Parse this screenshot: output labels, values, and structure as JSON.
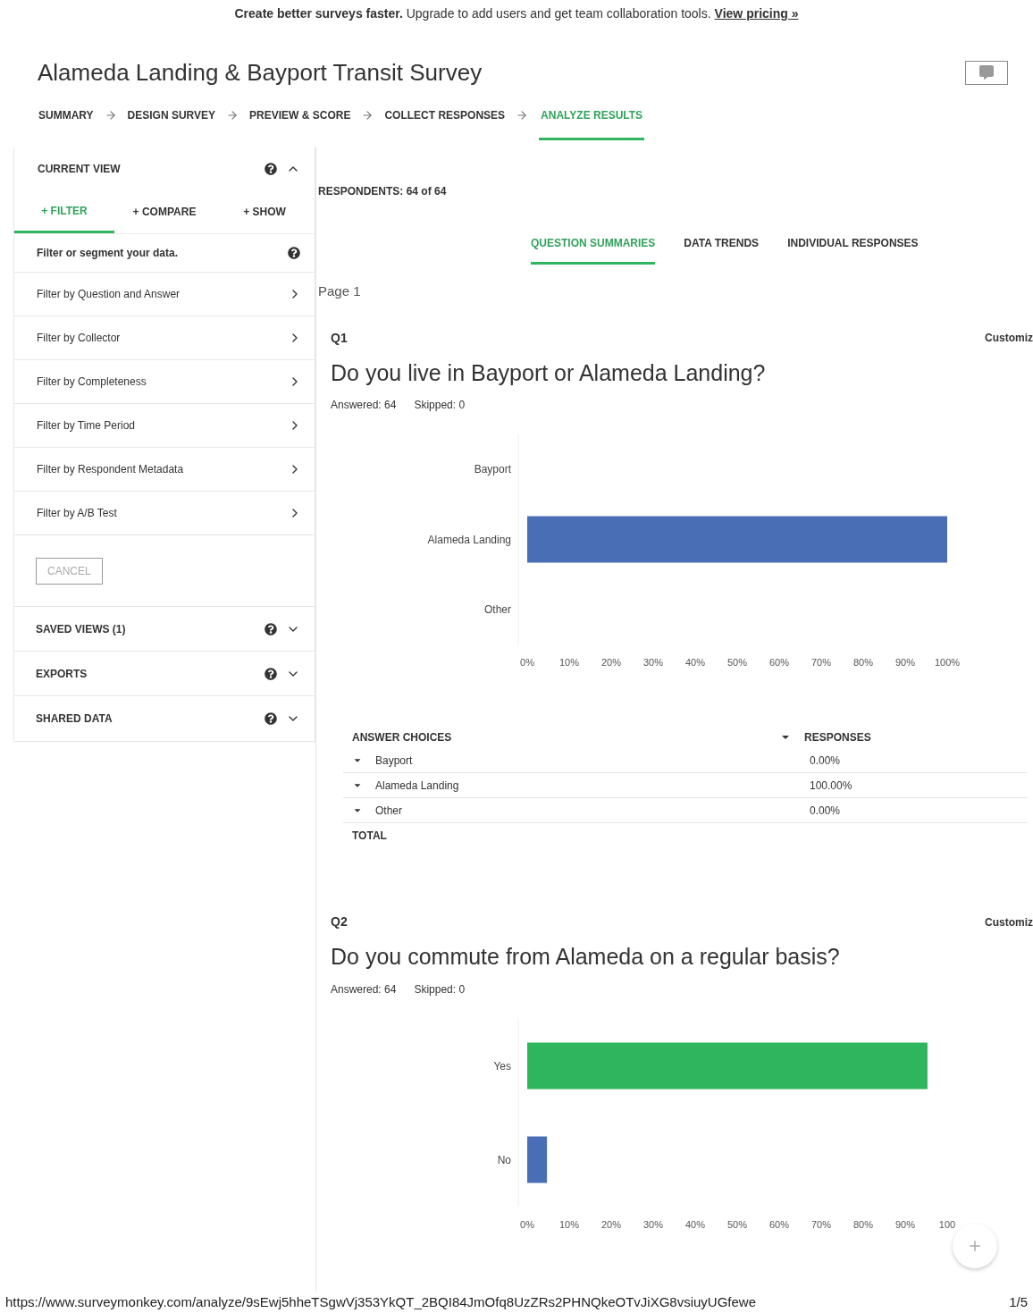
{
  "banner": {
    "text": "**Create better surveys faster.** Upgrade to add users and get team collaboration tools.",
    "link": "View pricing »"
  },
  "survey_title": "Alameda Landing & Bayport Transit Survey",
  "steps": [
    {
      "label": "SUMMARY",
      "selected": false
    },
    {
      "label": "DESIGN SURVEY",
      "selected": false
    },
    {
      "label": "PREVIEW & SCORE",
      "selected": false
    },
    {
      "label": "COLLECT RESPONSES",
      "selected": false
    },
    {
      "label": "ANALYZE RESULTS",
      "selected": true
    }
  ],
  "sidebar": {
    "current_view": {
      "title": "CURRENT VIEW",
      "expanded": true,
      "tabs": [
        {
          "label": "+ FILTER",
          "selected": true
        },
        {
          "label": "+ COMPARE",
          "selected": false
        },
        {
          "label": "+ SHOW",
          "selected": false
        }
      ],
      "hint": "Filter or segment your data.",
      "filters": [
        "Filter by Question and Answer",
        "Filter by Collector",
        "Filter by Completeness",
        "Filter by Time Period",
        "Filter by Respondent Metadata",
        "Filter by A/B Test"
      ],
      "cancel_button": "CANCEL"
    },
    "sections": [
      {
        "title": "SAVED VIEWS (1)",
        "expanded": false
      },
      {
        "title": "EXPORTS",
        "expanded": false
      },
      {
        "title": "SHARED DATA",
        "expanded": false
      }
    ]
  },
  "respondents": "RESPONDENTS: 64 of 64",
  "view_tabs": [
    {
      "label": "QUESTION SUMMARIES",
      "selected": true
    },
    {
      "label": "DATA TRENDS",
      "selected": false
    },
    {
      "label": "INDIVIDUAL RESPONSES",
      "selected": false
    }
  ],
  "page_label": "Page 1",
  "questions": [
    {
      "number": "Q1",
      "customize": "Customiz",
      "title": "Do you live in Bayport or Alameda Landing?",
      "answered": "Answered: 64",
      "skipped": "Skipped: 0",
      "chart_data": {
        "type": "bar",
        "orientation": "horizontal",
        "categories": [
          "Bayport",
          "Alameda Landing",
          "Other"
        ],
        "values": [
          0,
          100,
          0
        ],
        "colors": [
          "#4a6eb5",
          "#4a6eb5",
          "#4a6eb5"
        ],
        "xlim": [
          0,
          100
        ],
        "xticks": [
          {
            "value": 0,
            "label": "0%"
          },
          {
            "value": 10,
            "label": "10%"
          },
          {
            "value": 20,
            "label": "20%"
          },
          {
            "value": 30,
            "label": "30%"
          },
          {
            "value": 40,
            "label": "40%"
          },
          {
            "value": 50,
            "label": "50%"
          },
          {
            "value": 60,
            "label": "60%"
          },
          {
            "value": 70,
            "label": "70%"
          },
          {
            "value": 80,
            "label": "80%"
          },
          {
            "value": 90,
            "label": "90%"
          },
          {
            "value": 100,
            "label": "100%"
          }
        ]
      },
      "table": {
        "columns": [
          "ANSWER CHOICES",
          "RESPONSES"
        ],
        "rows": [
          [
            "Bayport",
            "0.00%"
          ],
          [
            "Alameda Landing",
            "100.00%"
          ],
          [
            "Other",
            "0.00%"
          ]
        ],
        "total": "TOTAL"
      }
    },
    {
      "number": "Q2",
      "customize": "Customiz",
      "title": "Do you commute from Alameda on a regular basis?",
      "answered": "Answered: 64",
      "skipped": "Skipped: 0",
      "chart_data": {
        "type": "bar",
        "orientation": "horizontal",
        "categories": [
          "Yes",
          "No"
        ],
        "values": [
          95.3,
          4.7
        ],
        "colors": [
          "#2fb55e",
          "#4a6eb5"
        ],
        "xlim": [
          0,
          100
        ],
        "xticks": [
          {
            "value": 0,
            "label": "0%"
          },
          {
            "value": 10,
            "label": "10%"
          },
          {
            "value": 20,
            "label": "20%"
          },
          {
            "value": 30,
            "label": "30%"
          },
          {
            "value": 40,
            "label": "40%"
          },
          {
            "value": 50,
            "label": "50%"
          },
          {
            "value": 60,
            "label": "60%"
          },
          {
            "value": 70,
            "label": "70%"
          },
          {
            "value": 80,
            "label": "80%"
          },
          {
            "value": 90,
            "label": "90%"
          },
          {
            "value": 100,
            "label": "100"
          }
        ]
      }
    }
  ],
  "footer": {
    "url": "https://www.surveymonkey.com/analyze/9sEwj5hheTSgwVj353YkQT_2BQI84JmOfq8UzZRs2PHNQkeOTvJiXG8vsiuyUGfewe",
    "page": "1/5"
  }
}
